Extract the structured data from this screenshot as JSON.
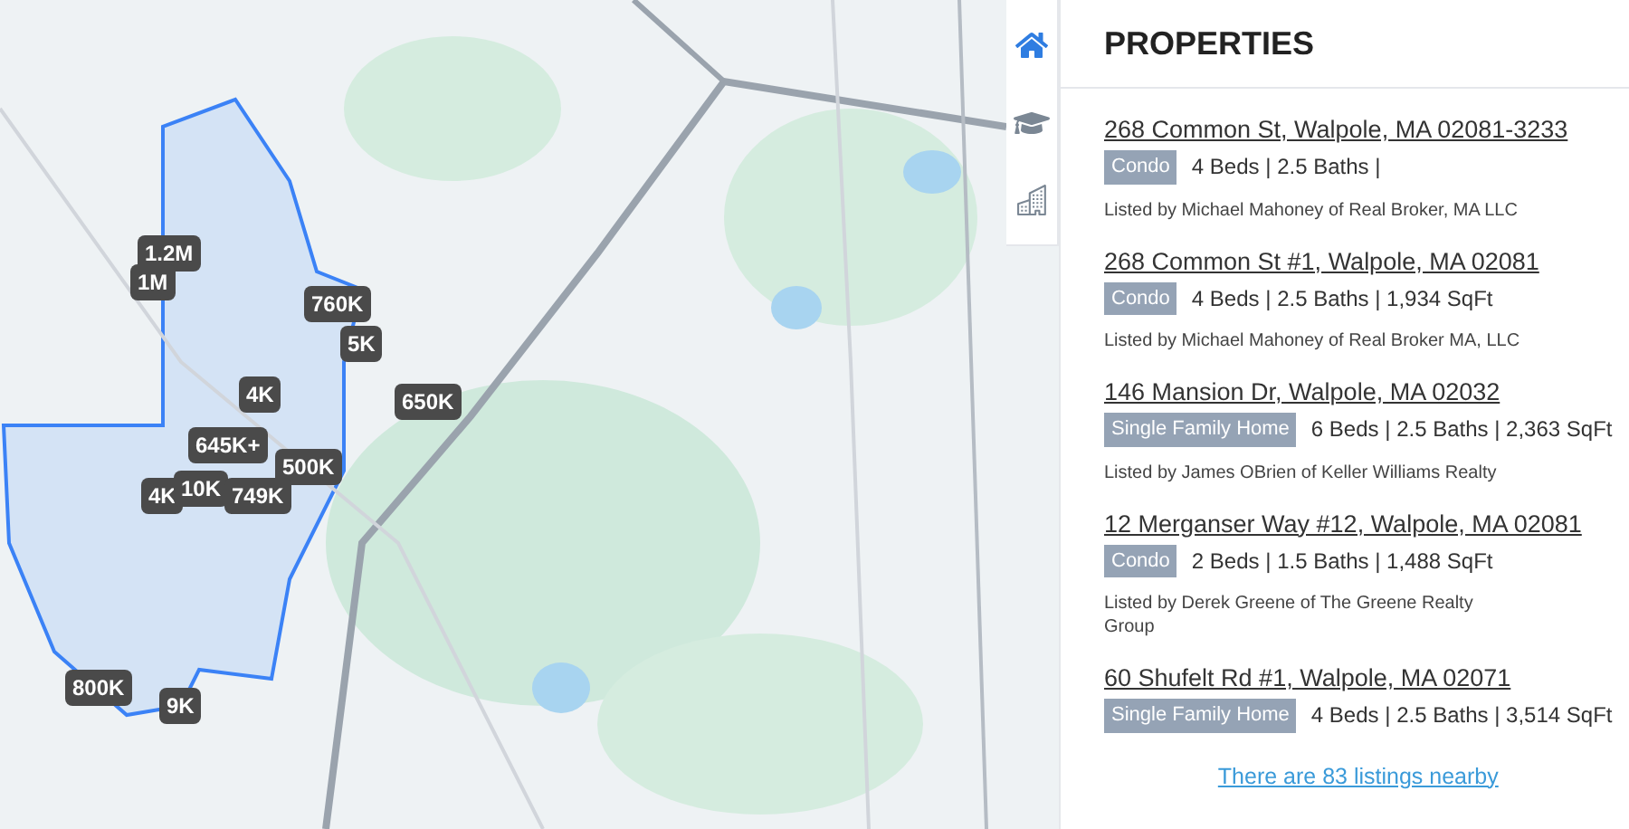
{
  "map": {
    "markers": [
      {
        "label": "1.2M"
      },
      {
        "label": "1M"
      },
      {
        "label": "760K"
      },
      {
        "label": "5K"
      },
      {
        "label": "4K"
      },
      {
        "label": "650K"
      },
      {
        "label": "645K+"
      },
      {
        "label": "500K"
      },
      {
        "label": "4K"
      },
      {
        "label": "10K"
      },
      {
        "label": "749K"
      },
      {
        "label": "800K"
      },
      {
        "label": "9K"
      }
    ]
  },
  "side_tabs": [
    {
      "kind": "home",
      "selected": true
    },
    {
      "kind": "school",
      "selected": false
    },
    {
      "kind": "building",
      "selected": false
    }
  ],
  "panel": {
    "title": "PROPERTIES",
    "listings": [
      {
        "address": "268 Common St, Walpole, MA 02081-3233",
        "type": "Condo",
        "details": "4 Beds | 2.5 Baths |",
        "agent": "Listed by Michael Mahoney of Real Broker, MA LLC"
      },
      {
        "address": "268 Common St #1, Walpole, MA 02081",
        "type": "Condo",
        "details": "4 Beds | 2.5 Baths | 1,934 SqFt",
        "agent": "Listed by Michael Mahoney of Real Broker MA, LLC"
      },
      {
        "address": "146 Mansion Dr, Walpole, MA 02032",
        "type": "Single Family Home",
        "details": "6 Beds | 2.5 Baths | 2,363 SqFt",
        "agent": "Listed by James OBrien of Keller Williams Realty"
      },
      {
        "address": "12 Merganser Way #12, Walpole, MA 02081",
        "type": "Condo",
        "details": "2 Beds | 1.5 Baths | 1,488 SqFt",
        "agent": "Listed by Derek Greene of The Greene Realty Group"
      },
      {
        "address": "60 Shufelt Rd #1, Walpole, MA 02071",
        "type": "Single Family Home",
        "details": "4 Beds | 2.5 Baths | 3,514 SqFt"
      }
    ],
    "more_link": "There are 83 listings nearby"
  }
}
